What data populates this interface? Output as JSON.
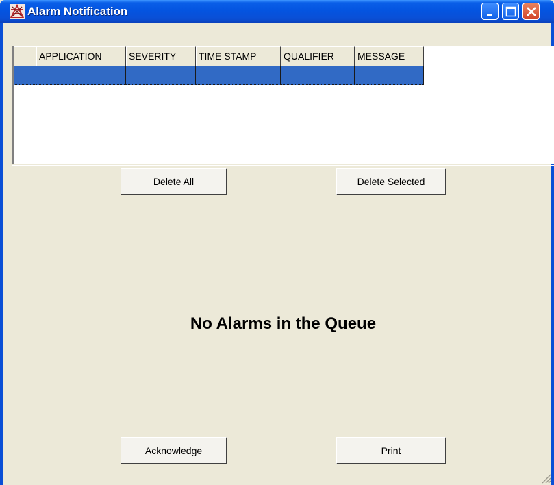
{
  "window": {
    "title": "Alarm Notification",
    "icon": "alarm-app-icon",
    "controls": [
      "minimize-icon",
      "maximize-icon",
      "close-icon"
    ]
  },
  "table": {
    "columns": [
      "",
      "APPLICATION",
      "SEVERITY",
      "TIME STAMP",
      "QUALIFIER",
      "MESSAGE"
    ],
    "rows": [
      [
        "",
        "",
        "",
        "",
        "",
        ""
      ]
    ],
    "selected_row_color": "#316AC5"
  },
  "top_buttons": {
    "delete_all": "Delete All",
    "delete_selected": "Delete Selected"
  },
  "status_message": "No Alarms in the Queue",
  "bottom_buttons": {
    "acknowledge": "Acknowledge",
    "print": "Print"
  },
  "colors": {
    "titlebar": "#0454E0",
    "background": "#ECE9D8",
    "selection": "#316AC5",
    "close_button": "#D2442A"
  }
}
